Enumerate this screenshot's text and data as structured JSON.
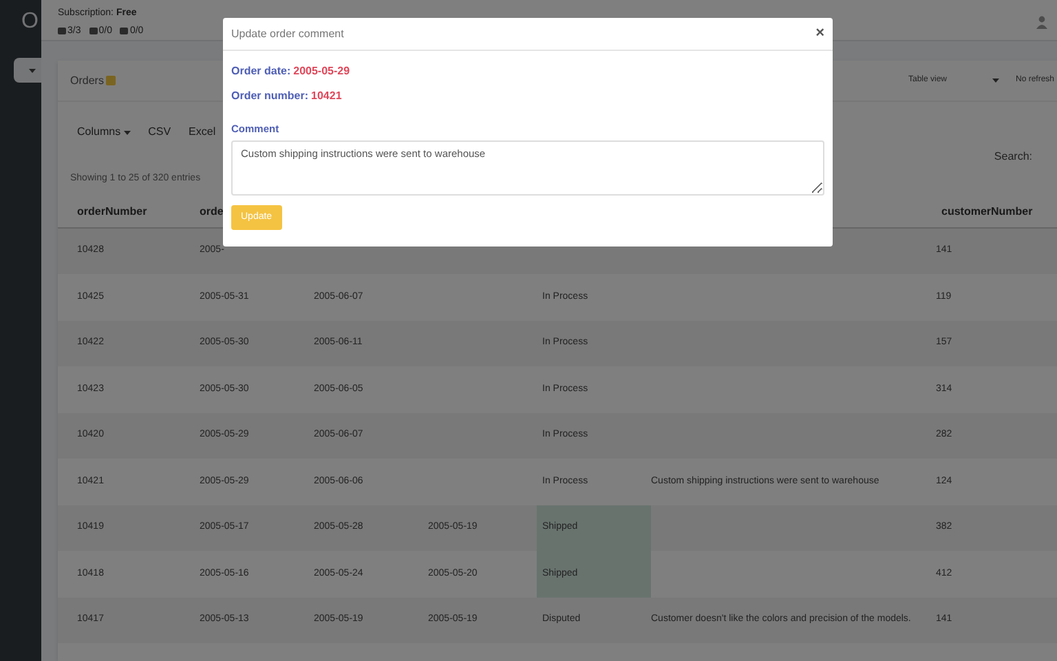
{
  "sidebar": {
    "logo": "O"
  },
  "header": {
    "subscription_label": "Subscription:",
    "subscription_value": "Free",
    "counters": [
      "3/3",
      "0/0",
      "0/0"
    ]
  },
  "card": {
    "title": "Orders",
    "view_select": "Table view",
    "refresh_select": "No refresh",
    "toolbar": [
      "Columns",
      "CSV",
      "Excel"
    ],
    "info": "Showing 1 to 25 of 320 entries",
    "search_label": "Search:"
  },
  "table": {
    "columns": [
      "orderNumber",
      "orde",
      "",
      "",
      "",
      "",
      "customerNumber"
    ],
    "rows": [
      {
        "cells": [
          "10428",
          "2005-",
          "",
          "",
          "",
          "",
          "141"
        ],
        "kind": "in_process"
      },
      {
        "cells": [
          "10425",
          "2005-05-31",
          "2005-06-07",
          "",
          "In Process",
          "",
          "119"
        ],
        "kind": "in_process"
      },
      {
        "cells": [
          "10422",
          "2005-05-30",
          "2005-06-11",
          "",
          "In Process",
          "",
          "157"
        ],
        "kind": "in_process"
      },
      {
        "cells": [
          "10423",
          "2005-05-30",
          "2005-06-05",
          "",
          "In Process",
          "",
          "314"
        ],
        "kind": "in_process"
      },
      {
        "cells": [
          "10420",
          "2005-05-29",
          "2005-06-07",
          "",
          "In Process",
          "",
          "282"
        ],
        "kind": "in_process"
      },
      {
        "cells": [
          "10421",
          "2005-05-29",
          "2005-06-06",
          "",
          "In Process",
          "Custom shipping instructions were sent to warehouse",
          "124"
        ],
        "kind": "in_process"
      },
      {
        "cells": [
          "10419",
          "2005-05-17",
          "2005-05-28",
          "2005-05-19",
          "Shipped",
          "",
          "382"
        ],
        "kind": "shipped"
      },
      {
        "cells": [
          "10418",
          "2005-05-16",
          "2005-05-24",
          "2005-05-20",
          "Shipped",
          "",
          "412"
        ],
        "kind": "shipped"
      },
      {
        "cells": [
          "10417",
          "2005-05-13",
          "2005-05-19",
          "2005-05-19",
          "Disputed",
          "Customer doesn't like the colors and precision of the models.",
          "141"
        ],
        "kind": "disputed"
      }
    ]
  },
  "modal": {
    "title": "Update order comment",
    "close": "×",
    "date_label": "Order date:",
    "date_value": "2005-05-29",
    "number_label": "Order number:",
    "number_value": "10421",
    "comment_label": "Comment",
    "comment_value": "Custom shipping instructions were sent to warehouse",
    "button": "Update"
  }
}
